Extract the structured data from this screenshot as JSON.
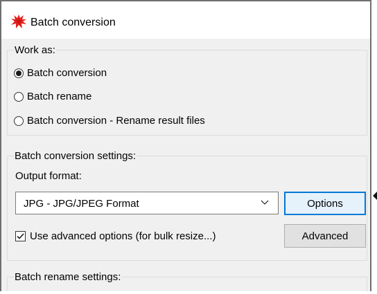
{
  "window": {
    "title": "Batch conversion"
  },
  "work_as": {
    "legend": "Work as:",
    "options": [
      {
        "label": "Batch conversion",
        "checked": true
      },
      {
        "label": "Batch rename",
        "checked": false
      },
      {
        "label": "Batch conversion - Rename result files",
        "checked": false
      }
    ]
  },
  "conversion_settings": {
    "legend": "Batch conversion settings:",
    "output_format_label": "Output format:",
    "output_format_value": "JPG - JPG/JPEG Format",
    "options_button": "Options",
    "advanced_checkbox_label": "Use advanced options (for bulk resize...)",
    "advanced_checked": true,
    "advanced_button": "Advanced"
  },
  "rename_settings": {
    "legend": "Batch rename settings:"
  }
}
